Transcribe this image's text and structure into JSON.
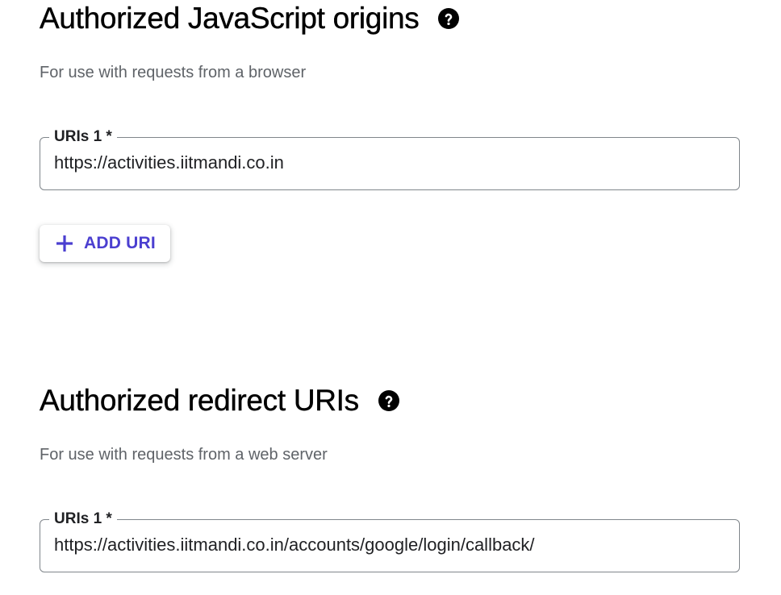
{
  "js_origins": {
    "title": "Authorized JavaScript origins",
    "subtitle": "For use with requests from a browser",
    "help_icon": "help-circle-icon",
    "uris": [
      {
        "label": "URIs 1 *",
        "value": "https://activities.iitmandi.co.in"
      }
    ],
    "add_button": {
      "label": "ADD URI",
      "icon": "plus-icon"
    }
  },
  "redirect_uris": {
    "title": "Authorized redirect URIs",
    "subtitle": "For use with requests from a web server",
    "help_icon": "help-circle-icon",
    "uris": [
      {
        "label": "URIs 1 *",
        "value": "https://activities.iitmandi.co.in/accounts/google/login/callback/"
      }
    ]
  },
  "colors": {
    "accent": "#4b3fd0",
    "heading": "#000000",
    "subtitle": "#5f6368",
    "field_border": "#80868b"
  }
}
